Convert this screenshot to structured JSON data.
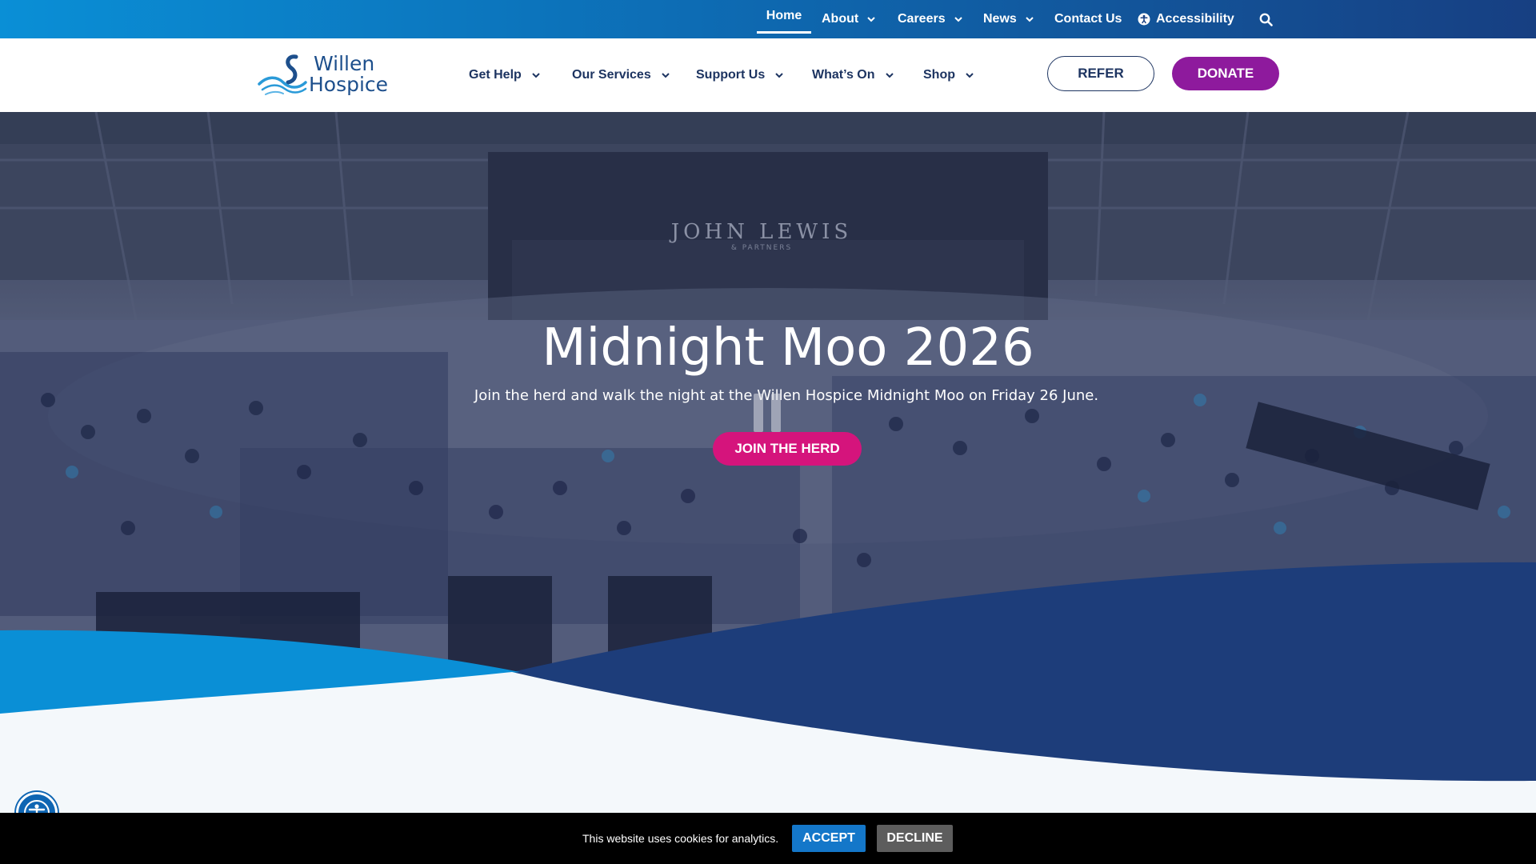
{
  "topnav": {
    "items": [
      {
        "label": "Home",
        "active": true,
        "dropdown": false
      },
      {
        "label": "About",
        "dropdown": true
      },
      {
        "label": "Careers",
        "dropdown": true
      },
      {
        "label": "News",
        "dropdown": true
      },
      {
        "label": "Contact Us",
        "dropdown": false
      },
      {
        "label": "Accessibility",
        "icon": "accessibility-icon"
      }
    ],
    "search_icon": "search-icon"
  },
  "logo": {
    "line1": "Willen",
    "line2": "Hospice"
  },
  "mainnav": {
    "items": [
      {
        "label": "Get Help"
      },
      {
        "label": "Our Services"
      },
      {
        "label": "Support Us"
      },
      {
        "label": "What’s On"
      },
      {
        "label": "Shop"
      }
    ]
  },
  "buttons": {
    "refer": "REFER",
    "donate": "DONATE"
  },
  "hero": {
    "title": "Midnight Moo 2026",
    "subtitle": "Join the herd and walk the night at the Willen Hospice Midnight Moo on Friday 26 June.",
    "cta": "JOIN THE HERD",
    "storefront_sign": "JOHN LEWIS",
    "storefront_sub": "& PARTNERS"
  },
  "cookie": {
    "text": "This website uses cookies for analytics.",
    "accept": "ACCEPT",
    "decline": "DECLINE"
  },
  "colors": {
    "topbar_start": "#0a8fd6",
    "topbar_end": "#173f82",
    "navy": "#1d3461",
    "donate": "#8e1a9d",
    "cta_pink": "#d5147c",
    "accept_blue": "#1477c9",
    "decline_grey": "#5d5d5d"
  }
}
